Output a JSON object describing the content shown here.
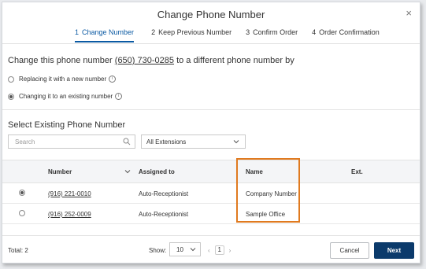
{
  "dialog": {
    "title": "Change Phone Number",
    "close_label": "×"
  },
  "steps": [
    {
      "num": "1",
      "label": "Change Number",
      "active": true
    },
    {
      "num": "2",
      "label": "Keep Previous Number",
      "active": false
    },
    {
      "num": "3",
      "label": "Confirm Order",
      "active": false
    },
    {
      "num": "4",
      "label": "Order Confirmation",
      "active": false
    }
  ],
  "change": {
    "prefix": "Change this phone number",
    "phone": "(650) 730-0285",
    "suffix": "to a different phone number by",
    "options": [
      {
        "label": "Replacing it with a new number",
        "checked": false
      },
      {
        "label": "Changing it to an existing number",
        "checked": true
      }
    ]
  },
  "select_section": {
    "title": "Select Existing Phone Number",
    "search_placeholder": "Search",
    "extensions_value": "All Extensions"
  },
  "table": {
    "columns": [
      "Number",
      "Assigned to",
      "Name",
      "Ext."
    ],
    "rows": [
      {
        "number": "(916) 221-0010",
        "assigned_to": "Auto-Receptionist",
        "name": "Company Number",
        "ext": "",
        "selected": true
      },
      {
        "number": "(916) 252-0009",
        "assigned_to": "Auto-Receptionist",
        "name": "Sample Office",
        "ext": "",
        "selected": false
      }
    ]
  },
  "footer": {
    "total": "Total: 2",
    "show_label": "Show:",
    "show_value": "10",
    "page_prev": "‹",
    "page_current": "1",
    "page_next": "›",
    "cancel": "Cancel",
    "next": "Next"
  },
  "colors": {
    "accent": "#0b5aa3",
    "primary_button": "#0b3a6b",
    "highlight": "#e07a1f"
  }
}
